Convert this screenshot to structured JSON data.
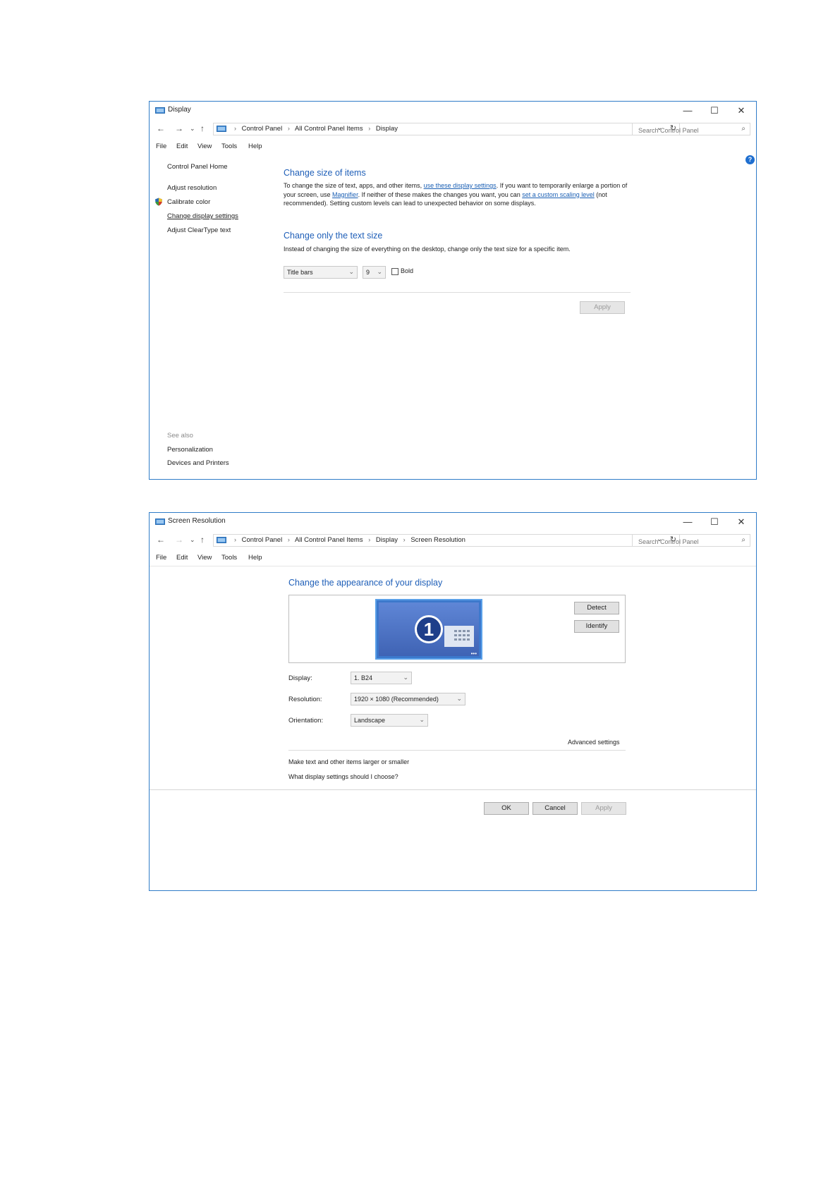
{
  "colors": {
    "accent": "#1f5fb8",
    "link": "#1a5fb4",
    "window_border": "#2f7cc8"
  },
  "display_window": {
    "title": "Display",
    "controls": {
      "minimize": "—",
      "maximize": "☐",
      "close": "✕"
    },
    "breadcrumb": [
      "Control Panel",
      "All Control Panel Items",
      "Display"
    ],
    "search_placeholder": "Search Control Panel",
    "menu": [
      "File",
      "Edit",
      "View",
      "Tools",
      "Help"
    ],
    "sidebar": {
      "home": "Control Panel Home",
      "items": [
        "Adjust resolution",
        "Calibrate color",
        "Change display settings",
        "Adjust ClearType text"
      ],
      "see_also_label": "See also",
      "see_also": [
        "Personalization",
        "Devices and Printers"
      ]
    },
    "section1": {
      "heading": "Change size of items",
      "p1": "To change the size of text, apps, and other items, ",
      "link1": "use these display settings",
      "p2": ". If you want to temporarily enlarge a portion of your screen, use ",
      "link2": "Magnifier",
      "p3": ". If neither of these makes the changes you want, you can ",
      "link3": "set a custom scaling level",
      "p4": " (not recommended). Setting custom levels can lead to unexpected behavior on some displays."
    },
    "section2": {
      "heading": "Change only the text size",
      "desc": "Instead of changing the size of everything on the desktop, change only the text size for a specific item.",
      "item_select": "Title bars",
      "size_select": "9",
      "bold_label": "Bold",
      "apply": "Apply"
    }
  },
  "resolution_window": {
    "title": "Screen Resolution",
    "controls": {
      "minimize": "—",
      "maximize": "☐",
      "close": "✕"
    },
    "breadcrumb": [
      "Control Panel",
      "All Control Panel Items",
      "Display",
      "Screen Resolution"
    ],
    "search_placeholder": "Search Control Panel",
    "menu": [
      "File",
      "Edit",
      "View",
      "Tools",
      "Help"
    ],
    "heading": "Change the appearance of your display",
    "monitor_number": "1",
    "detect": "Detect",
    "identify": "Identify",
    "display_label": "Display:",
    "display_value": "1. B24",
    "resolution_label": "Resolution:",
    "resolution_value": "1920 × 1080 (Recommended)",
    "orientation_label": "Orientation:",
    "orientation_value": "Landscape",
    "advanced": "Advanced settings",
    "link1": "Make text and other items larger or smaller",
    "link2": "What display settings should I choose?",
    "ok": "OK",
    "cancel": "Cancel",
    "apply": "Apply"
  }
}
